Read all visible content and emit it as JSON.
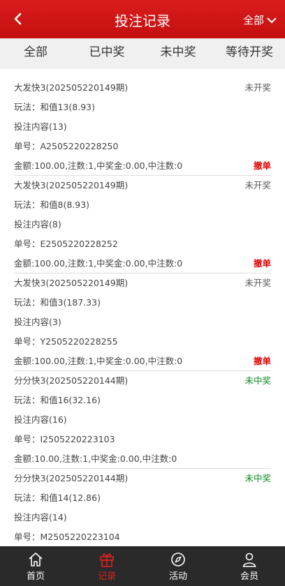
{
  "header": {
    "title": "投注记录",
    "filter_label": "全部"
  },
  "tabs": [
    "全部",
    "已中奖",
    "未中奖",
    "等待开奖"
  ],
  "records": [
    {
      "game": "大发快3(202505220149期)",
      "status": "未开奖",
      "status_type": "pending",
      "play": "玩法：和值13(8.93)",
      "content": "投注内容(13)",
      "order": "单号：A2505220228250",
      "amount": "金额:100.00,注数:1,中奖金:0.00,中注数:0",
      "action": "撤单"
    },
    {
      "game": "大发快3(202505220149期)",
      "status": "未开奖",
      "status_type": "pending",
      "play": "玩法：和值8(8.93)",
      "content": "投注内容(8)",
      "order": "单号：E2505220228252",
      "amount": "金额:100.00,注数:1,中奖金:0.00,中注数:0",
      "action": "撤单"
    },
    {
      "game": "大发快3(202505220149期)",
      "status": "未开奖",
      "status_type": "pending",
      "play": "玩法：和值3(187.33)",
      "content": "投注内容(3)",
      "order": "单号：Y2505220228255",
      "amount": "金额:100.00,注数:1,中奖金:0.00,中注数:0",
      "action": "撤单"
    },
    {
      "game": "分分快3(202505220144期)",
      "status": "未中奖",
      "status_type": "lose",
      "play": "玩法：和值16(32.16)",
      "content": "投注内容(16)",
      "order": "单号：I2505220223103",
      "amount": "金额:10.00,注数:1,中奖金:0.00,中注数:0",
      "action": ""
    },
    {
      "game": "分分快3(202505220144期)",
      "status": "未中奖",
      "status_type": "lose",
      "play": "玩法：和值14(12.86)",
      "content": "投注内容(14)",
      "order": "单号：M2505220223104",
      "amount": "",
      "action": ""
    }
  ],
  "nav": [
    {
      "label": "首页",
      "icon": "home-icon",
      "active": false
    },
    {
      "label": "记录",
      "icon": "gift-icon",
      "active": true
    },
    {
      "label": "活动",
      "icon": "compass-icon",
      "active": false
    },
    {
      "label": "会员",
      "icon": "user-icon",
      "active": false
    }
  ],
  "colors": {
    "header": "#d21414",
    "active_nav": "#e02020",
    "lose_status": "#0a8a1a",
    "cancel": "#e60000"
  }
}
